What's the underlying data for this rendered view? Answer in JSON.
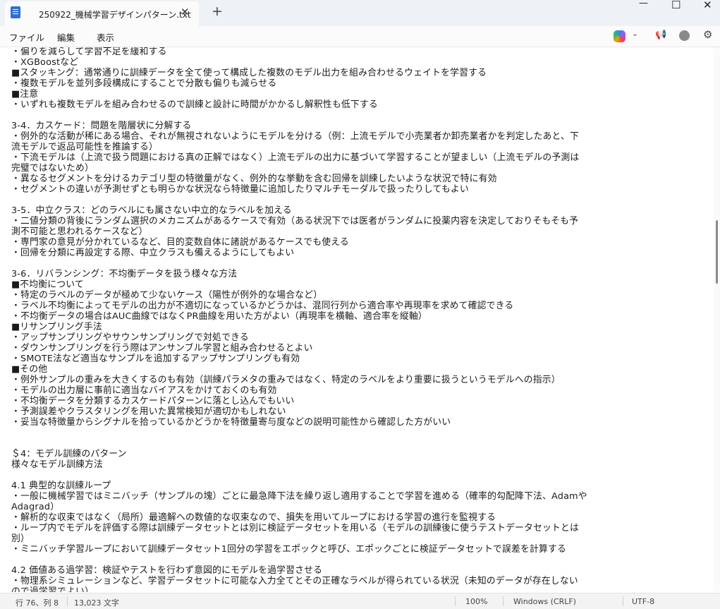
{
  "tab": {
    "title": "250922_機械学習デザインパターン.txt",
    "close": "✕",
    "new_tab": "+"
  },
  "window": {
    "minimize": "—",
    "maximize": "☐",
    "close": "✕"
  },
  "menu": [
    "ファイル",
    "編集",
    "表示"
  ],
  "toolbar_icons": [
    "copilot-icon",
    "chevron-down-icon",
    "megaphone-icon",
    "account-icon",
    "settings-icon"
  ],
  "toolbar_glyphs": {
    "chevron": "⌄",
    "megaphone": "📢",
    "settings": "⚙"
  },
  "text_lines": [
    "・偏りを減らして学習不足を緩和する",
    "・XGBoostなど",
    "■スタッキング：通常通りに訓練データを全て使って構成した複数のモデル出力を組み合わせるウェイトを学習する",
    "・複数モデルを並列多段構成にすることで分散も偏りも減らせる",
    "■注意",
    "・いずれも複数モデルを組み合わせるので訓練と設計に時間がかかるし解釈性も低下する",
    "",
    "3-4．カスケード：問題を階層状に分解する",
    "・例外的な活動が稀にある場合、それが無視されないようにモデルを分ける（例：上流モデルで小売業者か卸売業者かを判定したあと、下",
    "流モデルで返品可能性を推論する）",
    "・下流モデルは（上流で扱う問題における真の正解ではなく）上流モデルの出力に基づいて学習することが望ましい（上流モデルの予測は",
    "完璧ではないため）",
    "・異なるセグメントを分けるカテゴリ型の特徴量がなく、例外的な挙動を含む回帰を訓練したいような状況で特に有効",
    "・セグメントの違いが予測せずとも明らかな状況なら特徴量に追加したりマルチモーダルで扱ったりしてもよい",
    "",
    "3-5．中立クラス：どのラベルにも属さない中立的なラベルを加える",
    "・二値分類の背後にランダム選択のメカニズムがあるケースで有効（ある状況下では医者がランダムに投薬内容を決定しておりそもそも予",
    "測不可能と思われるケースなど）",
    "・専門家の意見が分かれているなど、目的変数自体に諸説があるケースでも使える",
    "・回帰を分類に再設定する際、中立クラスも備えるようにしてもよい",
    "",
    "3-6．リバランシング：不均衡データを扱う様々な方法",
    "■不均衡について",
    "・特定のラベルのデータが極めて少ないケース（陽性が例外的な場合など）",
    "・ラベル不均衡によってモデルの出力が不適切になっているかどうかは、混同行列から適合率や再現率を求めて確認できる",
    "・不均衡データの場合はAUC曲線ではなくPR曲線を用いた方がよい（再現率を横軸、適合率を縦軸）",
    "■リサンプリング手法",
    "・アップサンプリングやサウンサンプリングで対処できる",
    "・ダウンサンプリングを行う際はアンサンブル学習と組み合わせるとよい",
    "・SMOTE法など適当なサンプルを追加するアップサンプリングも有効",
    "■その他",
    "・例外サンプルの重みを大きくするのも有効（訓練パラメタの重みではなく、特定のラベルをより重要に扱うというモデルへの指示）",
    "・モデルの出力層に事前に適当なバイアスをかけておくのも有効",
    "・不均衡データを分類するカスケードパターンに落とし込んでもいい",
    "・予測誤差やクラスタリングを用いた異常検知が適切かもしれない",
    "・妥当な特徴量からシグナルを拾っているかどうかを特徴量寄与度などの説明可能性から確認した方がいい",
    "",
    "",
    "＄4：モデル訓練のパターン",
    "様々なモデル訓練方法",
    "",
    "4.1 典型的な訓練ループ",
    "・一般に機械学習ではミニバッチ（サンプルの塊）ごとに最急降下法を繰り返し適用することで学習を進める（確率的勾配降下法、Adamや",
    "Adagrad）",
    "・解析的な収束ではなく（局所）最適解への数値的な収束なので、損失を用いてループにおける学習の進行を監視する",
    "・ループ内でモデルを評価する際は訓練データセットとは別に検証データセットを用いる（モデルの訓練後に使うテストデータセットとは",
    "別）",
    "・ミニバッチ学習ループにおいて訓練データセット1回分の学習をエポックと呼び、エポックごとに検証データセットで誤差を計算する",
    "",
    "4.2 価値ある過学習：検証やテストを行わず意図的にモデルを過学習させる",
    "・物理系シミュレーションなど、学習データセットに可能な入力全てとその正確なラベルが得られている状況（未知のデータが存在しない",
    "ので過学習でよい）"
  ],
  "status": {
    "position": "行 76、列 8",
    "chars": "13,023 文字",
    "zoom": "100%",
    "line_ending": "Windows (CRLF)",
    "encoding": "UTF-8"
  }
}
